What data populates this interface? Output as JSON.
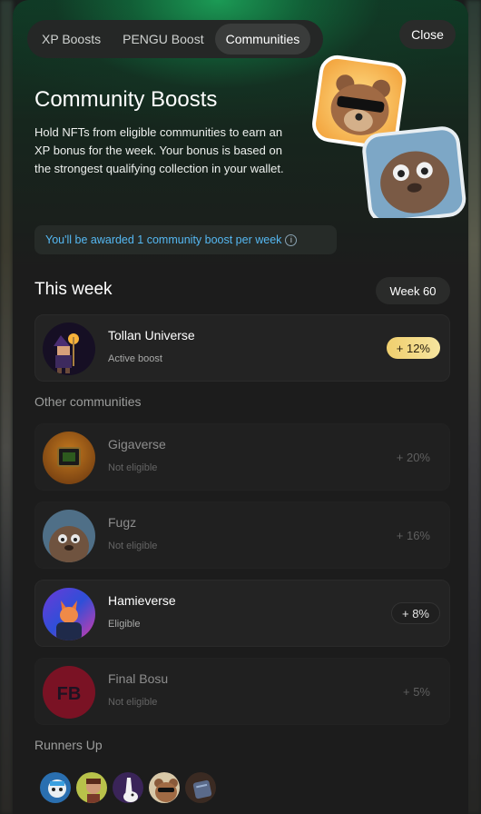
{
  "tabs": [
    {
      "label": "XP Boosts"
    },
    {
      "label": "PENGU Boost"
    },
    {
      "label": "Communities"
    }
  ],
  "close_label": "Close",
  "hero": {
    "title": "Community Boosts",
    "description": "Hold NFTs from eligible communities to earn an XP bonus for the week. Your bonus is based on the strongest qualifying collection in your wallet."
  },
  "info_text": "You'll be awarded 1 community boost per week",
  "this_week": {
    "heading": "This week",
    "week_label": "Week 60",
    "active": {
      "name": "Tollan Universe",
      "status": "Active boost",
      "boost": "+ 12%"
    }
  },
  "other_heading": "Other communities",
  "communities": [
    {
      "name": "Gigaverse",
      "status": "Not eligible",
      "boost": "+ 20%"
    },
    {
      "name": "Fugz",
      "status": "Not eligible",
      "boost": "+ 16%"
    },
    {
      "name": "Hamieverse",
      "status": "Eligible",
      "boost": "+ 8%"
    },
    {
      "name": "Final Bosu",
      "status": "Not eligible",
      "boost": "+ 5%",
      "logo_text": "FB"
    }
  ],
  "runners_heading": "Runners Up",
  "colors": {
    "accent_green": "#1ca058",
    "info_blue": "#55b8f2",
    "gold": "#f0cf6e"
  }
}
